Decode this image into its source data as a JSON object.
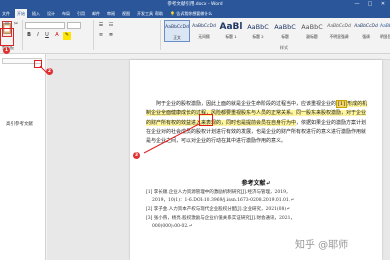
{
  "title_bar": {
    "title": "参考文献引用.docx - Word",
    "minimize": "—",
    "maximize": "□",
    "close": "✕"
  },
  "menu_tabs": [
    {
      "label": "文件"
    },
    {
      "label": "开始"
    },
    {
      "label": "插入"
    },
    {
      "label": "设计"
    },
    {
      "label": "布局"
    },
    {
      "label": "引用"
    },
    {
      "label": "邮件"
    },
    {
      "label": "审阅"
    },
    {
      "label": "视图"
    },
    {
      "label": "开发工具"
    },
    {
      "label": "帮助"
    }
  ],
  "tell_me": "告诉我你想要做什么",
  "ribbon": {
    "groups": {
      "clipboard": "剪贴板",
      "styles": "样式"
    },
    "styles": [
      {
        "preview": "AaBbCcDd",
        "name": "正文"
      },
      {
        "preview": "AaBbCcDd",
        "name": "无间隔"
      },
      {
        "preview": "AaBl",
        "name": "标题 1"
      },
      {
        "preview": "AaBbC",
        "name": "标题 2"
      },
      {
        "preview": "AaBbC",
        "name": "标题"
      },
      {
        "preview": "AaBbC",
        "name": "副标题"
      },
      {
        "preview": "AaBbCcDd",
        "name": "不明显强调"
      },
      {
        "preview": "AaBbCcDd",
        "name": "强调"
      },
      {
        "preview": "AaBbCcDd",
        "name": "明显强调"
      }
    ]
  },
  "left_pane": {
    "nav_item": "高引参考文献"
  },
  "document": {
    "paragraph": {
      "p1": "阿于企业的股权激励，因此上面的就是企业生命阶段的过程当中，应该重视企业的",
      "cite": "[1]",
      "p2": "形成的机制企业全面健康成长的过程，风险都要重视股东与人员的正常关系。同一股东来股权激励，对于企业的财产所有权的效益进入来表现的，同时也是提前会员在自身行为中",
      "p3": "，依据如果企业的激励方案计划在企业对的社会成员的股权计划进行有效的发展，也是企业的财产所有权进行的意义进行激励作用就是与企业之间，可以对企业的行动在其中进行",
      "p4": "激励作用的意义。"
    },
    "references_title": "参考文献↵",
    "references": [
      "[1] 李长顺.企业人力资源管理中的激励机制研究[J].经济与管理，2019，",
      "2019，10(1)：1-6.DOI:10.3969/j.issn.1673-0208.2019.01.01.↵",
      "[2] 李子金.人力资本产权与现代企业股权分配[J].企业研究，2021(08)↵",
      "[3] 张小燕，杨亮.股权激励与企业价值关系实证研究[J].财会通讯，2021，",
      "000(000):00-02.↵"
    ]
  },
  "callouts": [
    "1",
    "2",
    "3"
  ],
  "watermark": "知乎 @耶师"
}
